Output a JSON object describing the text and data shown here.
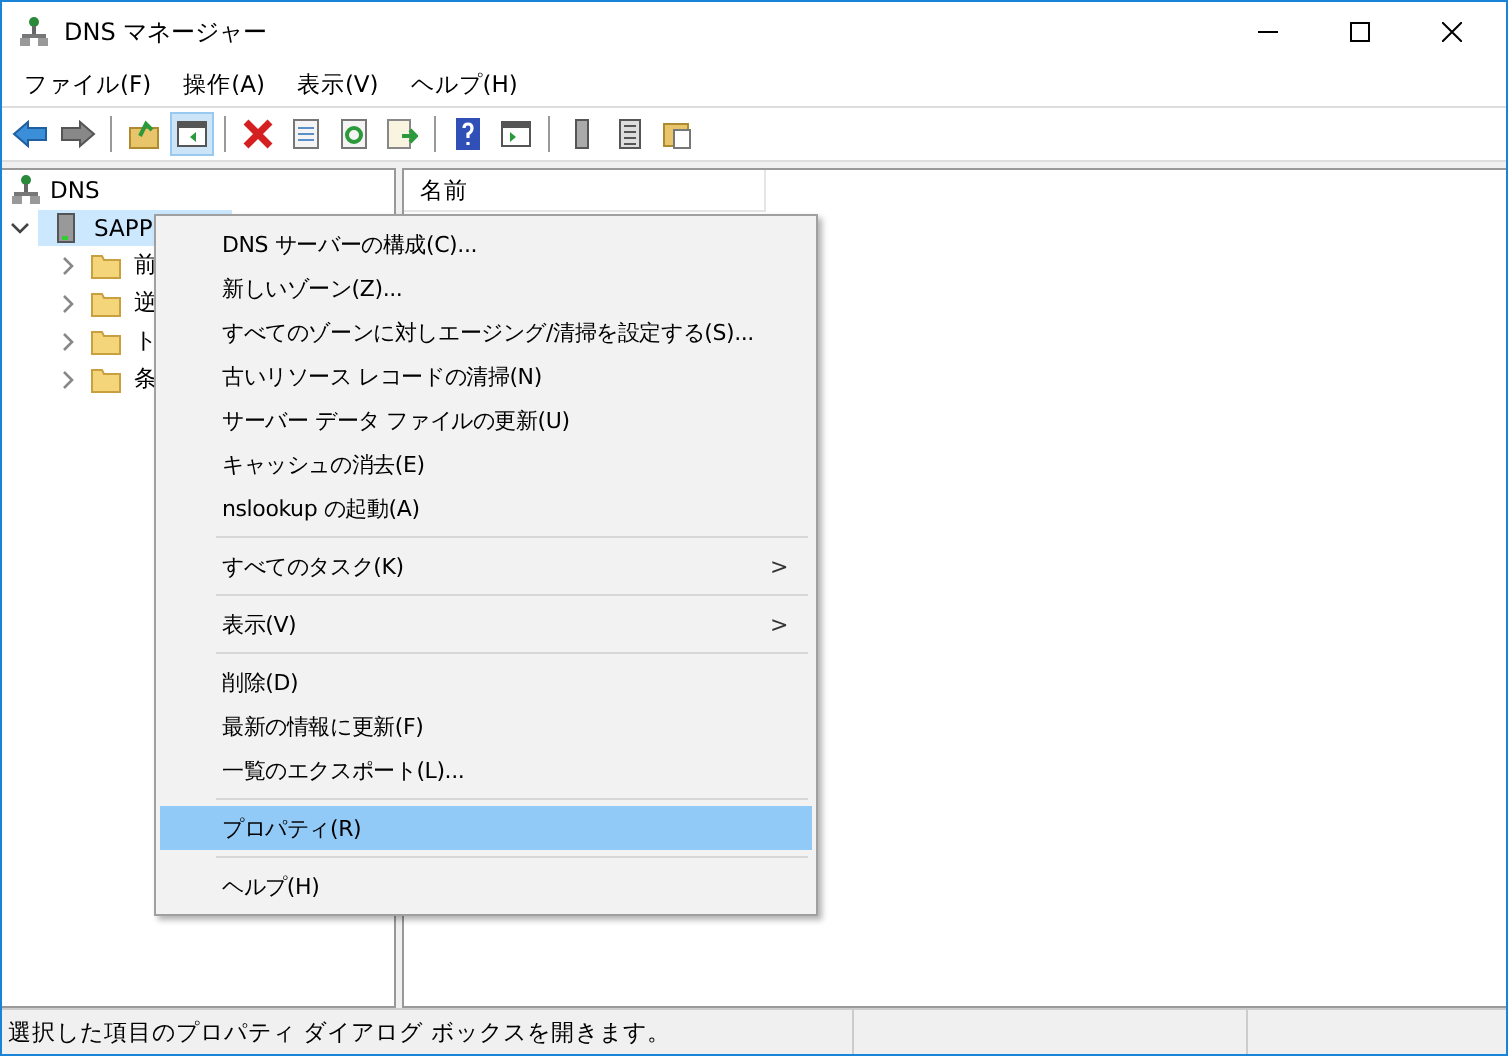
{
  "window": {
    "title": "DNS マネージャー"
  },
  "menu_bar": [
    "ファイル(F)",
    "操作(A)",
    "表示(V)",
    "ヘルプ(H)"
  ],
  "toolbar": [
    {
      "kind": "back",
      "pressed": false
    },
    {
      "kind": "forward",
      "pressed": false
    },
    {
      "kind": "sep"
    },
    {
      "kind": "up",
      "pressed": false
    },
    {
      "kind": "tree",
      "pressed": true
    },
    {
      "kind": "sep"
    },
    {
      "kind": "delete",
      "pressed": false
    },
    {
      "kind": "props",
      "pressed": false
    },
    {
      "kind": "refresh",
      "pressed": false
    },
    {
      "kind": "export",
      "pressed": false
    },
    {
      "kind": "sep"
    },
    {
      "kind": "help",
      "pressed": false
    },
    {
      "kind": "console",
      "pressed": false
    },
    {
      "kind": "sep"
    },
    {
      "kind": "server",
      "pressed": false
    },
    {
      "kind": "list",
      "pressed": false
    },
    {
      "kind": "folder",
      "pressed": false
    }
  ],
  "tree": {
    "label": "DNS",
    "children": [
      {
        "label": "SAPP",
        "selected": true,
        "expanded": true,
        "children": [
          {
            "label": "前",
            "expanded": false
          },
          {
            "label": "逆",
            "expanded": false
          },
          {
            "label": "ト",
            "expanded": false
          },
          {
            "label": "条",
            "expanded": false
          }
        ]
      }
    ]
  },
  "list_header": [
    "名前"
  ],
  "context_menu": [
    {
      "kind": "item",
      "label": "DNS サーバーの構成(C)...",
      "selected": false
    },
    {
      "kind": "item",
      "label": "新しいゾーン(Z)...",
      "selected": false
    },
    {
      "kind": "item",
      "label": "すべてのゾーンに対しエージング/清掃を設定する(S)...",
      "selected": false
    },
    {
      "kind": "item",
      "label": "古いリソース レコードの清掃(N)",
      "selected": false
    },
    {
      "kind": "item",
      "label": "サーバー データ ファイルの更新(U)",
      "selected": false
    },
    {
      "kind": "item",
      "label": "キャッシュの消去(E)",
      "selected": false
    },
    {
      "kind": "item",
      "label": "nslookup の起動(A)",
      "selected": false
    },
    {
      "kind": "separator"
    },
    {
      "kind": "submenu",
      "label": "すべてのタスク(K)",
      "arrow": ">",
      "selected": false
    },
    {
      "kind": "separator"
    },
    {
      "kind": "submenu",
      "label": "表示(V)",
      "arrow": ">",
      "selected": false
    },
    {
      "kind": "separator"
    },
    {
      "kind": "item",
      "label": "削除(D)",
      "selected": false
    },
    {
      "kind": "item",
      "label": "最新の情報に更新(F)",
      "selected": false
    },
    {
      "kind": "item",
      "label": "一覧のエクスポート(L)...",
      "selected": false
    },
    {
      "kind": "separator"
    },
    {
      "kind": "item",
      "label": "プロパティ(R)",
      "selected": true
    },
    {
      "kind": "separator"
    },
    {
      "kind": "item",
      "label": "ヘルプ(H)",
      "selected": false
    }
  ],
  "status_bar": "選択した項目のプロパティ ダイアログ ボックスを開きます。"
}
